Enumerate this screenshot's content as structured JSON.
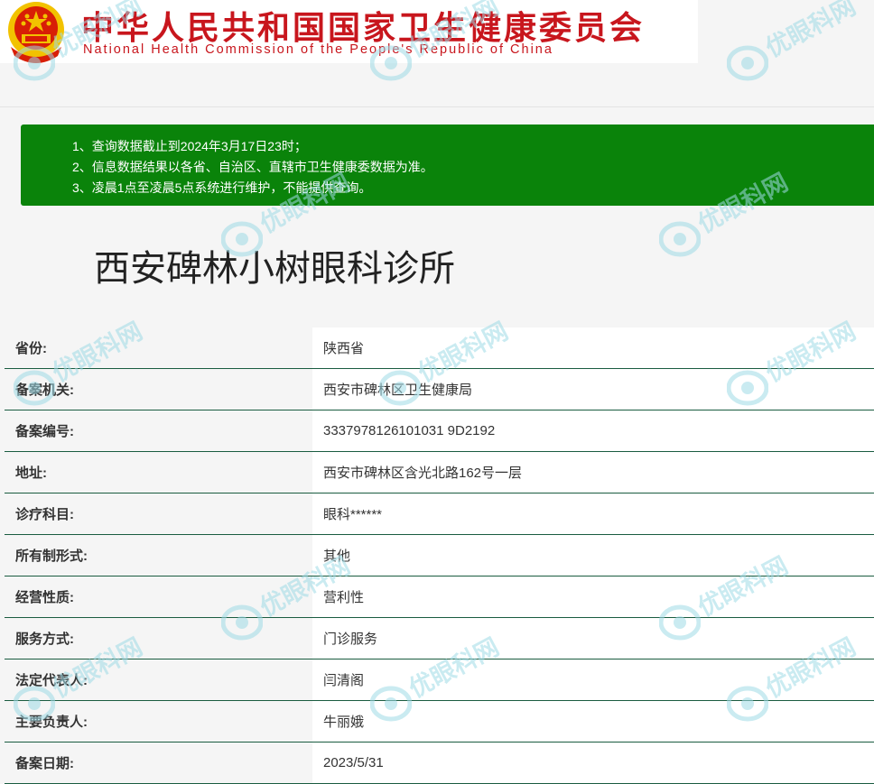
{
  "header": {
    "title_cn": "中华人民共和国国家卫生健康委员会",
    "title_en": "National Health Commission of the People's Republic of China",
    "emblem_icon": "national-emblem-icon",
    "colors": {
      "brand_red": "#c8161d",
      "emblem_gold": "#f2c200"
    }
  },
  "notice": {
    "background": "#0a830a",
    "lines": [
      "1、查询数据截止到2024年3月17日23时；",
      "2、信息数据结果以各省、自治区、直辖市卫生健康委数据为准。",
      "3、凌晨1点至凌晨5点系统进行维护，不能提供查询。"
    ]
  },
  "clinic": {
    "name": "西安碑林小树眼科诊所"
  },
  "records": [
    {
      "label": "省份:",
      "value": "陕西省"
    },
    {
      "label": "备案机关:",
      "value": "西安市碑林区卫生健康局"
    },
    {
      "label": "备案编号:",
      "value": "3337978126101031 9D2192"
    },
    {
      "label": "地址:",
      "value": "西安市碑林区含光北路162号一层"
    },
    {
      "label": "诊疗科目:",
      "value": "眼科******"
    },
    {
      "label": "所有制形式:",
      "value": "其他"
    },
    {
      "label": "经营性质:",
      "value": "营利性"
    },
    {
      "label": "服务方式:",
      "value": "门诊服务"
    },
    {
      "label": "法定代表人:",
      "value": "闫清阁"
    },
    {
      "label": "主要负责人:",
      "value": "牛丽娥"
    },
    {
      "label": "备案日期:",
      "value": "2023/5/31"
    }
  ],
  "watermark": {
    "text": "优眼科网",
    "color": "#9fdbe6"
  }
}
